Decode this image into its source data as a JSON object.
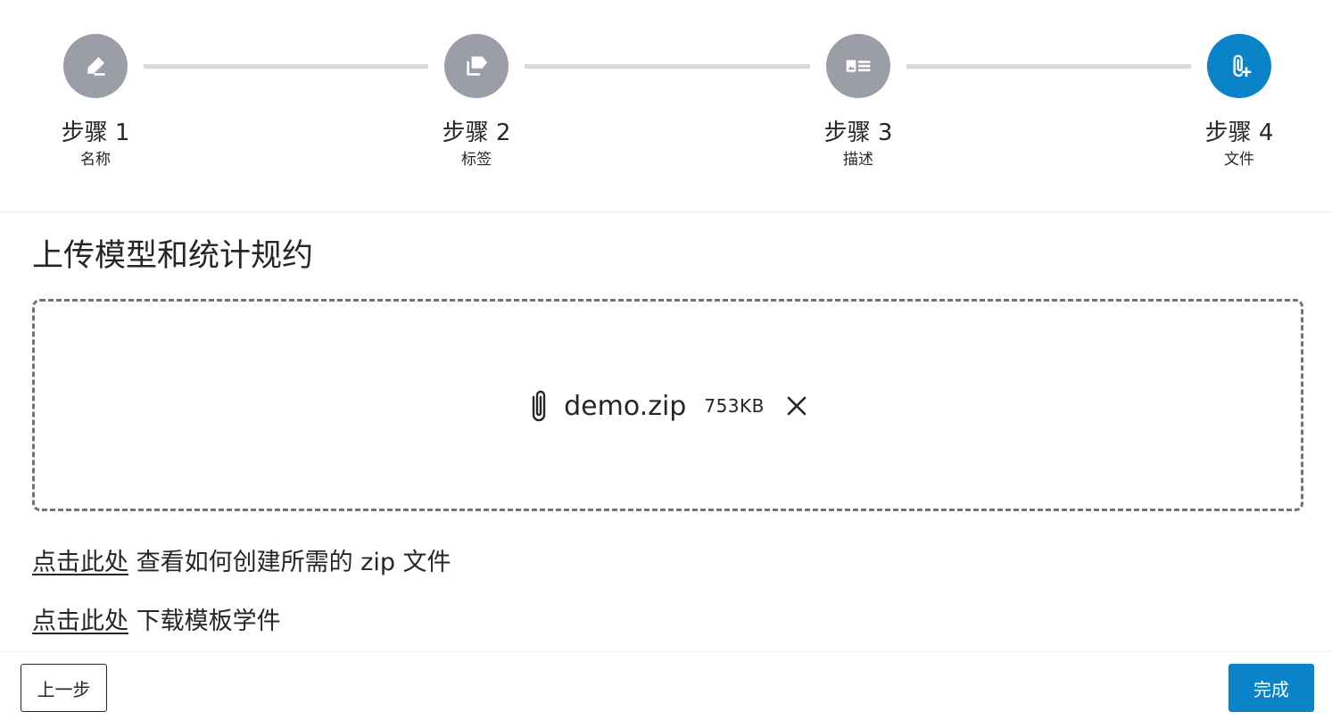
{
  "stepper": {
    "steps": [
      {
        "title": "步骤 1",
        "subtitle": "名称",
        "icon": "pencil-icon",
        "active": false
      },
      {
        "title": "步骤 2",
        "subtitle": "标签",
        "icon": "tag-icon",
        "active": false
      },
      {
        "title": "步骤 3",
        "subtitle": "描述",
        "icon": "description-card-icon",
        "active": false
      },
      {
        "title": "步骤 4",
        "subtitle": "文件",
        "icon": "attachment-add-icon",
        "active": true
      }
    ]
  },
  "main": {
    "title": "上传模型和统计规约"
  },
  "upload": {
    "file_name": "demo.zip",
    "file_size": "753KB"
  },
  "help": {
    "line1_link": "点击此处",
    "line1_text": " 查看如何创建所需的 zip 文件",
    "line2_link": "点击此处",
    "line2_text": " 下载模板学件"
  },
  "footer": {
    "prev_label": "上一步",
    "finish_label": "完成"
  },
  "colors": {
    "primary": "#0a83c8",
    "inactive_step": "#9b9ea6",
    "connector": "#d9d9d9"
  }
}
